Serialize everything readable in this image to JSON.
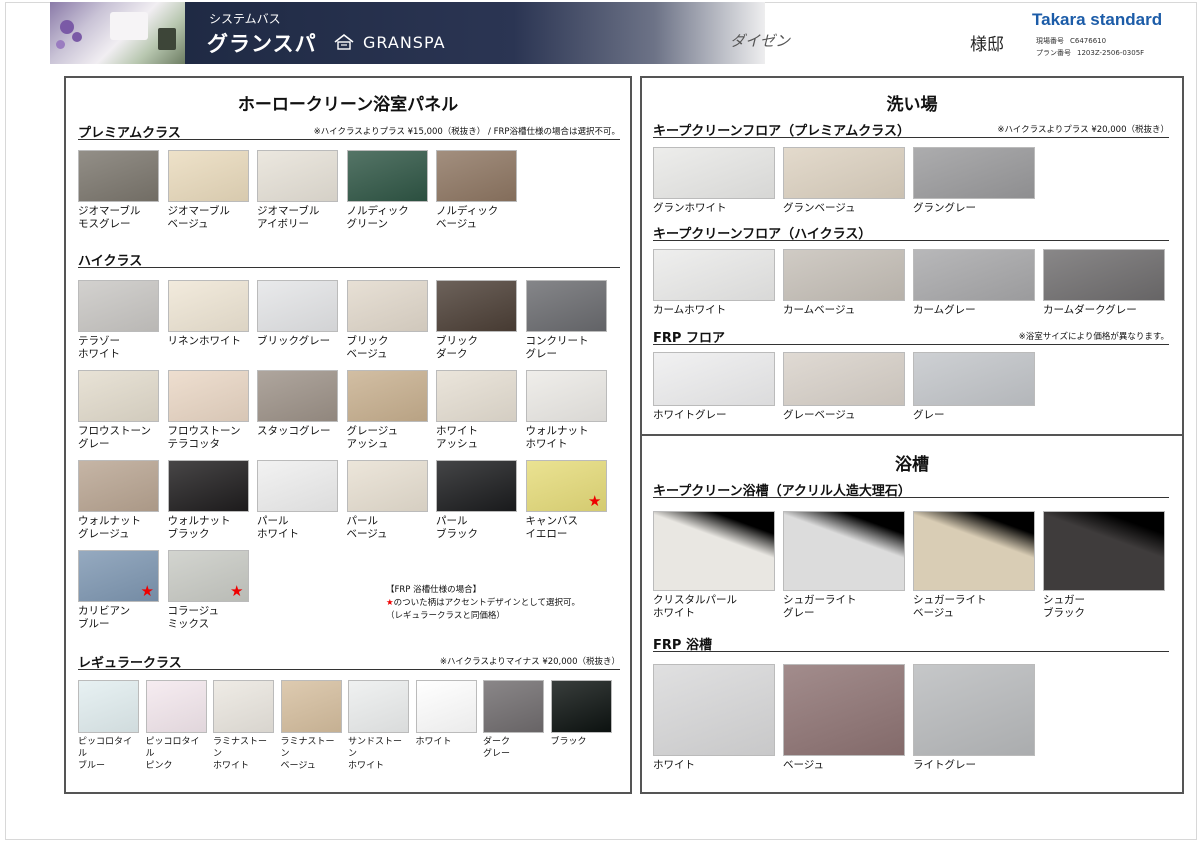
{
  "header": {
    "series_sub": "システムバス",
    "series_name": "グランスパ",
    "brand_text": "GRANSPA",
    "customer": "ダイゼン",
    "honorific": "様邸",
    "maker": "Takara standard",
    "meta": [
      {
        "label": "現場番号",
        "value": "C6476610"
      },
      {
        "label": "プラン番号",
        "value": "1203Z-2506-0305F"
      }
    ]
  },
  "left": {
    "title": "ホーロークリーン浴室パネル",
    "premium": {
      "title": "プレミアムクラス",
      "note": "※ハイクラスよりプラス ¥15,000（税抜き） / FRP浴槽仕様の場合は選択不可。",
      "items": [
        {
          "label": "ジオマーブル\nモスグレー",
          "color": "#7b766d"
        },
        {
          "label": "ジオマーブル\nベージュ",
          "color": "#eadbbd"
        },
        {
          "label": "ジオマーブル\nアイボリー",
          "color": "#e7e2d8"
        },
        {
          "label": "ノルディック\nグリーン",
          "color": "#2f5645"
        },
        {
          "label": "ノルディック\nベージュ",
          "color": "#8e7662"
        }
      ]
    },
    "high": {
      "title": "ハイクラス",
      "items": [
        {
          "label": "テラゾー\nホワイト",
          "color": "#c9c7c4",
          "star": false
        },
        {
          "label": "リネンホワイト",
          "color": "#efe6d5",
          "star": false
        },
        {
          "label": "ブリックグレー",
          "color": "#e4e5e7",
          "star": false
        },
        {
          "label": "ブリック\nベージュ",
          "color": "#e2d9cc",
          "star": false
        },
        {
          "label": "ブリック\nダーク",
          "color": "#4c3f36",
          "star": false
        },
        {
          "label": "コンクリート\nグレー",
          "color": "#6a6b6f",
          "star": false
        },
        {
          "label": "フロウストーン\nグレー",
          "color": "#e3dccd",
          "star": false
        },
        {
          "label": "フロウストーン\nテラコッタ",
          "color": "#ead7c5",
          "star": false
        },
        {
          "label": "スタッコグレー",
          "color": "#9d9288",
          "star": false
        },
        {
          "label": "グレージュ\nアッシュ",
          "color": "#c8b08f",
          "star": false
        },
        {
          "label": "ホワイト\nアッシュ",
          "color": "#e6dfd3",
          "star": false
        },
        {
          "label": "ウォルナット\nホワイト",
          "color": "#eceae6",
          "star": false
        },
        {
          "label": "ウォルナット\nグレージュ",
          "color": "#b9a592",
          "star": false
        },
        {
          "label": "ウォルナット\nブラック",
          "color": "#1f1d1e",
          "star": false
        },
        {
          "label": "パール\nホワイト",
          "color": "#efefef",
          "star": false
        },
        {
          "label": "パール\nベージュ",
          "color": "#e8e0d2",
          "star": false
        },
        {
          "label": "パール\nブラック",
          "color": "#1b1c1e",
          "star": false
        },
        {
          "label": "キャンバス\nイエロー",
          "color": "#e6dc7a",
          "star": true
        },
        {
          "label": "カリビアン\nブルー",
          "color": "#7e97b2",
          "star": true
        },
        {
          "label": "コラージュ\nミックス",
          "color": "#c9cbc5",
          "star": true
        }
      ],
      "star_glyph": "★",
      "frp_note": {
        "line1": "【FRP 浴槽仕様の場合】",
        "line2": "のついた柄はアクセントデザインとして選択可。",
        "line3": "（レギュラークラスと同価格）"
      }
    },
    "regular": {
      "title": "レギュラークラス",
      "note": "※ハイクラスよりマイナス ¥20,000（税抜き）",
      "items": [
        {
          "label": "ピッコロタイル\nブルー",
          "color": "#e2eef0"
        },
        {
          "label": "ピッコロタイル\nピンク",
          "color": "#f4e8ee"
        },
        {
          "label": "ラミナストーン\nホワイト",
          "color": "#ebe7e0"
        },
        {
          "label": "ラミナストーン\nベージュ",
          "color": "#d6bf9f"
        },
        {
          "label": "サンドストーン\nホワイト",
          "color": "#eceeee"
        },
        {
          "label": "ホワイト",
          "color": "#ffffff"
        },
        {
          "label": "ダーク\nグレー",
          "color": "#706c6e"
        },
        {
          "label": "ブラック",
          "color": "#0d1311"
        }
      ]
    }
  },
  "right": {
    "wash_title": "洗い場",
    "premium_floor": {
      "title": "キープクリーンフロア（プレミアムクラス）",
      "note": "※ハイクラスよりプラス ¥20,000（税抜き）",
      "items": [
        {
          "label": "グランホワイト",
          "color": "#e9e9e7"
        },
        {
          "label": "グランベージュ",
          "color": "#ddd2c1"
        },
        {
          "label": "グラングレー",
          "color": "#9a9a9c"
        }
      ]
    },
    "high_floor": {
      "title": "キープクリーンフロア（ハイクラス）",
      "items": [
        {
          "label": "カームホワイト",
          "color": "#ebebea"
        },
        {
          "label": "カームベージュ",
          "color": "#c6c0b8"
        },
        {
          "label": "カームグレー",
          "color": "#a8a8aa"
        },
        {
          "label": "カームダークグレー",
          "color": "#6f6d6e"
        }
      ]
    },
    "frp_floor": {
      "title": "FRP フロア",
      "note": "※浴室サイズにより価格が異なります。",
      "items": [
        {
          "label": "ホワイトグレー",
          "color": "#eeeeef"
        },
        {
          "label": "グレーベージュ",
          "color": "#d9d2ca"
        },
        {
          "label": "グレー",
          "color": "#c3c6ca"
        }
      ]
    },
    "tub_title": "浴槽",
    "kc_tub": {
      "title": "キープクリーン浴槽（アクリル人造大理石）",
      "items": [
        {
          "label": "クリスタルパール\nホワイト",
          "color": "#e9e7e2"
        },
        {
          "label": "シュガーライト\nグレー",
          "color": "#dcdcdc"
        },
        {
          "label": "シュガーライト\nベージュ",
          "color": "#d9cdb5"
        },
        {
          "label": "シュガー\nブラック",
          "color": "#3f3c3c"
        }
      ]
    },
    "frp_tub": {
      "title": "FRP 浴槽",
      "items": [
        {
          "label": "ホワイト",
          "color": "#d9d9da"
        },
        {
          "label": "ベージュ",
          "color": "#8e7373"
        },
        {
          "label": "ライトグレー",
          "color": "#b9bbbd"
        }
      ]
    }
  }
}
